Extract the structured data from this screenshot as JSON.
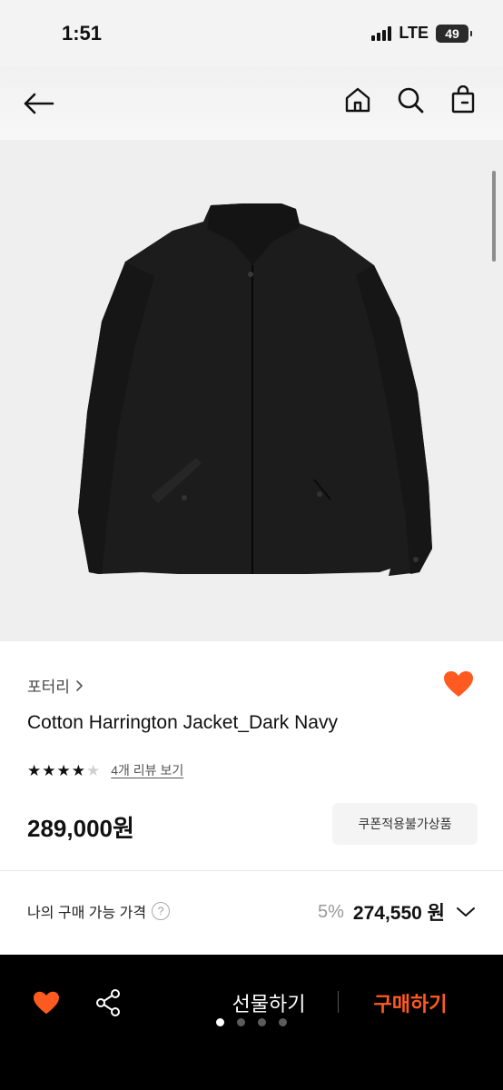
{
  "status_bar": {
    "time": "1:51",
    "network": "LTE",
    "battery": "49"
  },
  "nav": {
    "back_icon": "arrow-left-icon",
    "icons": [
      "home-icon",
      "search-icon",
      "shopping-bag-icon"
    ]
  },
  "product": {
    "image_alt": "black harrington jacket",
    "brand": "포터리",
    "title": "Cotton Harrington Jacket_Dark Navy",
    "rating": 4,
    "rating_max": 5,
    "review_link": "4개 리뷰 보기",
    "price": "289,000원",
    "coupon_badge": "쿠폰적용불가상품"
  },
  "my_price": {
    "label": "나의 구매 가능 가격",
    "help_icon": "?",
    "discount": "5%",
    "price": "274,550 원"
  },
  "bottom_bar": {
    "gift_label": "선물하기",
    "buy_label": "구매하기",
    "page_dots": 4,
    "active_dot": 0
  },
  "colors": {
    "accent": "#ff5a1f",
    "bottom_bar_bg": "#000000",
    "image_bg": "#efefef"
  }
}
